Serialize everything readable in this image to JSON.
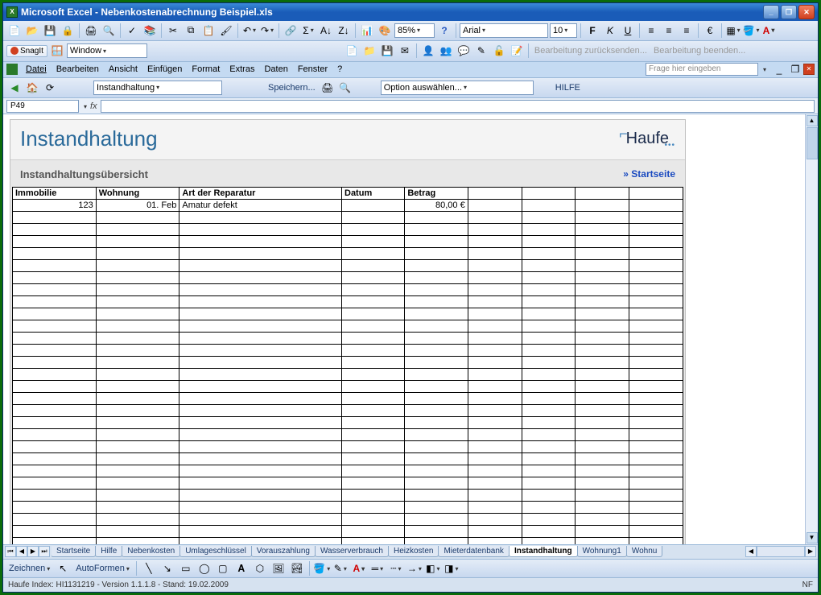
{
  "window": {
    "app_name": "Microsoft Excel",
    "doc_name": "Nebenkostenabrechnung Beispiel.xls"
  },
  "menubar": {
    "items": [
      "Datei",
      "Bearbeiten",
      "Ansicht",
      "Einfügen",
      "Format",
      "Extras",
      "Daten",
      "Fenster",
      "?"
    ],
    "help_placeholder": "Frage hier eingeben"
  },
  "toolbar_std": {
    "zoom": "85%",
    "font_name": "Arial",
    "font_size": "10"
  },
  "snagit": {
    "label": "SnagIt",
    "profile_label": "Window"
  },
  "custom_bar": {
    "review_undo": "Bearbeitung zurücksenden...",
    "review_end": "Bearbeitung beenden..."
  },
  "nav_bar": {
    "sheet_name": "Instandhaltung",
    "save_label": "Speichern...",
    "option_label": "Option auswählen...",
    "help_label": "HILFE"
  },
  "formula": {
    "cell_ref": "P49",
    "fx": "fx"
  },
  "document": {
    "title": "Instandhaltung",
    "logo_text": "Haufe",
    "subtitle": "Instandhaltungsübersicht",
    "start_link": "Startseite"
  },
  "table": {
    "headers": [
      "Immobilie",
      "Wohnung",
      "Art der Reparatur",
      "Datum",
      "Betrag",
      "",
      "",
      "",
      ""
    ],
    "rows": [
      {
        "immobilie": "123",
        "wohnung": "01. Feb",
        "art": "Amatur defekt",
        "datum": "",
        "betrag": "80,00 €"
      }
    ],
    "empty_rows": 28
  },
  "tabs": {
    "list": [
      "Startseite",
      "Hilfe",
      "Nebenkosten",
      "Umlageschlüssel",
      "Vorauszahlung",
      "Wasserverbrauch",
      "Heizkosten",
      "Mieterdatenbank",
      "Instandhaltung",
      "Wohnung1",
      "Wohnu"
    ],
    "active_index": 8
  },
  "drawbar": {
    "draw_label": "Zeichnen",
    "autoshapes_label": "AutoFormen"
  },
  "statusbar": {
    "left": "Haufe Index: HI1131219 - Version 1.1.1.8 - Stand: 19.02.2009",
    "right": "NF"
  }
}
